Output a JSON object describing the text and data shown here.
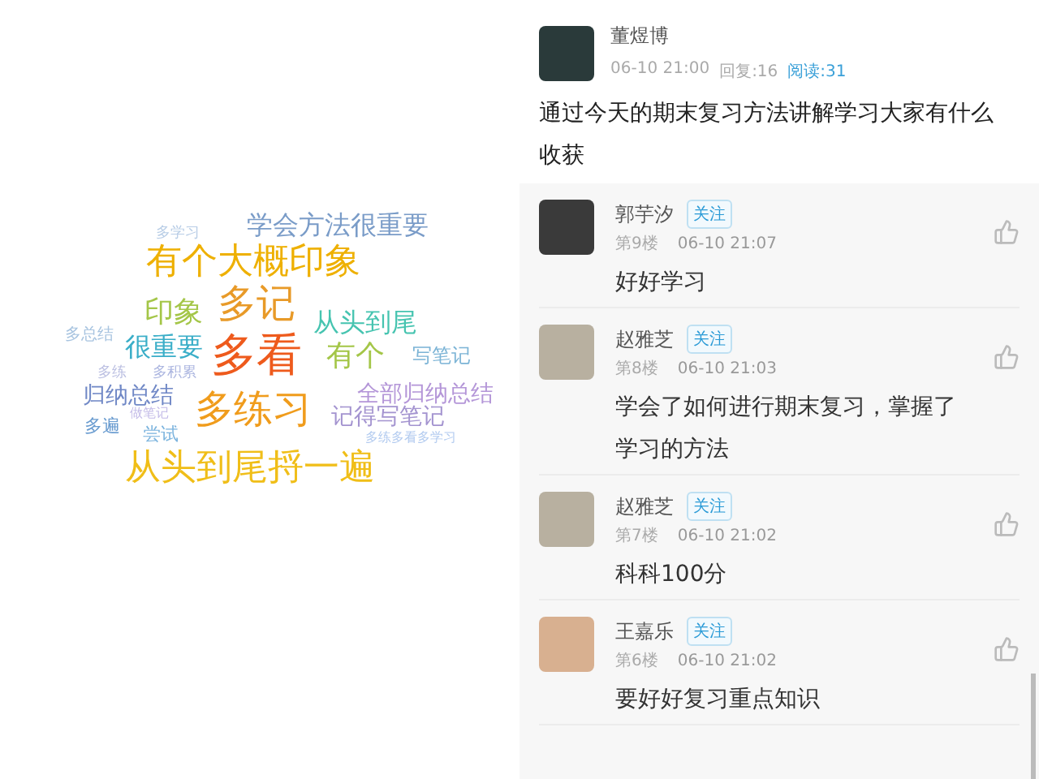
{
  "word_cloud": [
    {
      "text": "多学习",
      "color": "#b8cde6"
    },
    {
      "text": "学会方法很重要",
      "color": "#7a9cc8"
    },
    {
      "text": "有个大概印象",
      "color": "#eeb000"
    },
    {
      "text": "印象",
      "color": "#a4c648"
    },
    {
      "text": "多记",
      "color": "#e89a28"
    },
    {
      "text": "从头到尾",
      "color": "#46c4b0"
    },
    {
      "text": "多总结",
      "color": "#a8c4e0"
    },
    {
      "text": "很重要",
      "color": "#3aaec8"
    },
    {
      "text": "多看",
      "color": "#ee5a1c"
    },
    {
      "text": "有个",
      "color": "#a4c648"
    },
    {
      "text": "写笔记",
      "color": "#7cb4d6"
    },
    {
      "text": "多练",
      "color": "#bcc0e2"
    },
    {
      "text": "多积累",
      "color": "#acb6e0"
    },
    {
      "text": "归纳总结",
      "color": "#7088c6"
    },
    {
      "text": "多练习",
      "color": "#f09c1c"
    },
    {
      "text": "全部归纳总结",
      "color": "#b496d8"
    },
    {
      "text": "做笔记",
      "color": "#c4bce8"
    },
    {
      "text": "多遍",
      "color": "#6a9cd0"
    },
    {
      "text": "记得写笔记",
      "color": "#a494d0"
    },
    {
      "text": "尝试",
      "color": "#7cb4de"
    },
    {
      "text": "多练多看多学习",
      "color": "#b4ccf0"
    },
    {
      "text": "从头到尾捋一遍",
      "color": "#f0be18"
    }
  ],
  "post": {
    "author": "董煜博",
    "time": "06-10 21:00",
    "replies": "回复:16",
    "reads": "阅读:31",
    "text": "通过今天的期末复习方法讲解学习大家有什么收获"
  },
  "comments": [
    {
      "author": "郭芋汐",
      "follow": "关注",
      "floor": "第9楼",
      "time": "06-10 21:07",
      "text": "好好学习"
    },
    {
      "author": "赵雅芝",
      "follow": "关注",
      "floor": "第8楼",
      "time": "06-10 21:03",
      "text": "学会了如何进行期末复习，掌握了学习的方法"
    },
    {
      "author": "赵雅芝",
      "follow": "关注",
      "floor": "第7楼",
      "time": "06-10 21:02",
      "text": "科科100分"
    },
    {
      "author": "王嘉乐",
      "follow": "关注",
      "floor": "第6楼",
      "time": "06-10 21:02",
      "text": "要好好复习重点知识"
    }
  ]
}
